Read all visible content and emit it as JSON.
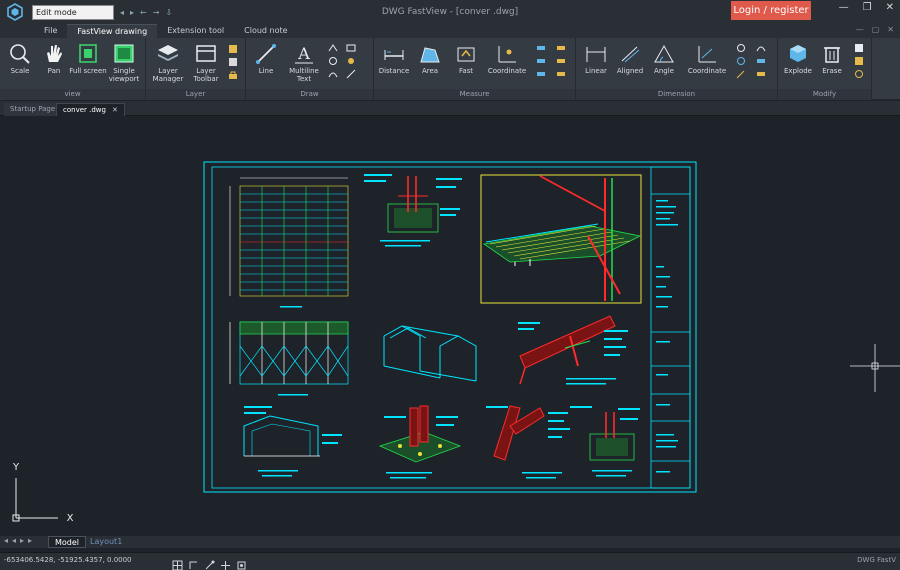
{
  "window": {
    "mode_select": "Edit mode",
    "title": "DWG FastView - [conver .dwg]",
    "login_label": "Login / register"
  },
  "ribbon_tabs": [
    "File",
    "FastView drawing",
    "Extension tool",
    "Cloud note"
  ],
  "panels": {
    "view": {
      "label": "view",
      "tools": [
        "Scale",
        "Pan",
        "Full screen",
        "Single viewport"
      ]
    },
    "layer": {
      "label": "Layer",
      "tools": [
        "Layer Manager",
        "Layer Toolbar"
      ]
    },
    "draw": {
      "label": "Draw",
      "tools": [
        "Line",
        "Multiline Text"
      ]
    },
    "measure": {
      "label": "Measure",
      "tools": [
        "Distance",
        "Area",
        "Fast",
        "Coordinate"
      ]
    },
    "dimension": {
      "label": "Dimension",
      "tools": [
        "Linear",
        "Aligned",
        "Angle",
        "Coordinate"
      ]
    },
    "modify": {
      "label": "Modify",
      "tools": [
        "Explode",
        "Erase"
      ]
    }
  },
  "doc_tabs": [
    "Startup Page",
    "conver .dwg"
  ],
  "layout_tabs": [
    "Model",
    "Layout1"
  ],
  "status": {
    "coords": "-653406.5428, -51925.4357, 0.0000",
    "app_name": "DWG FastV"
  },
  "ucs": {
    "x_label": "X",
    "y_label": "Y"
  },
  "drawing_captions": [
    "PURLIN PLAN",
    "STIFFENER BASE PLATE DETAIL (1:10)",
    "ELEVATION (1:100)",
    "CONNECTION DETAIL OF STEEL PORTAL FRAMES (1:20)",
    "SECTION OF STEEL PORTAL FRAMES (1:20)",
    "RIDGE BEAM TO STEEL PORTAL FRAME (1:10)",
    "HAUNCH TO STEEL PORTAL FRAME (1:10)",
    "LONGITUDINAL BASE PLATE DETAIL (1:10)"
  ],
  "colors": {
    "accent_login": "#e05a4b",
    "cad_cyan": "#00e5ff",
    "cad_red": "#ff2a2a",
    "cad_yellow": "#e8e33a",
    "cad_green": "#22e04a",
    "canvas_bg": "#1e232a"
  }
}
